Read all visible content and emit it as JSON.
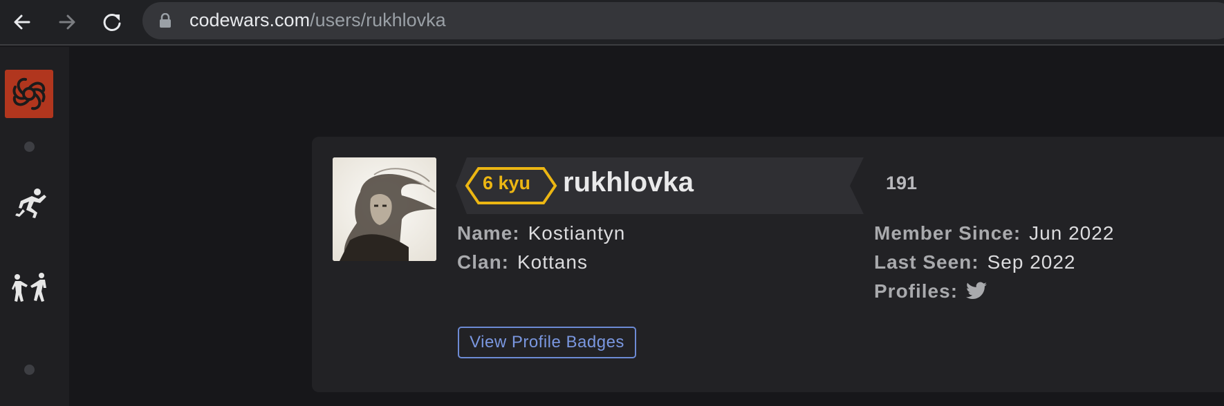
{
  "browser": {
    "url_host": "codewars.com",
    "url_path": "/users/rukhlovka"
  },
  "profile": {
    "rank": "6 kyu",
    "username": "rukhlovka",
    "honor": "191",
    "name_label": "Name:",
    "name_value": "Kostiantyn",
    "clan_label": "Clan:",
    "clan_value": "Kottans",
    "member_since_label": "Member Since:",
    "member_since_value": "Jun 2022",
    "last_seen_label": "Last Seen:",
    "last_seen_value": "Sep 2022",
    "profiles_label": "Profiles:",
    "badges_button": "View Profile Badges"
  },
  "colors": {
    "rank_yellow": "#ecb613",
    "logo_red": "#b1361e",
    "button_blue": "#6d8bd5"
  },
  "icons": {
    "back": "back-arrow-icon",
    "forward": "forward-arrow-icon",
    "reload": "reload-icon",
    "lock": "lock-icon",
    "logo": "codewars-logo-icon",
    "kata": "kata-practice-icon",
    "sparring": "sparring-icon",
    "profile_link": "twitter-icon"
  }
}
